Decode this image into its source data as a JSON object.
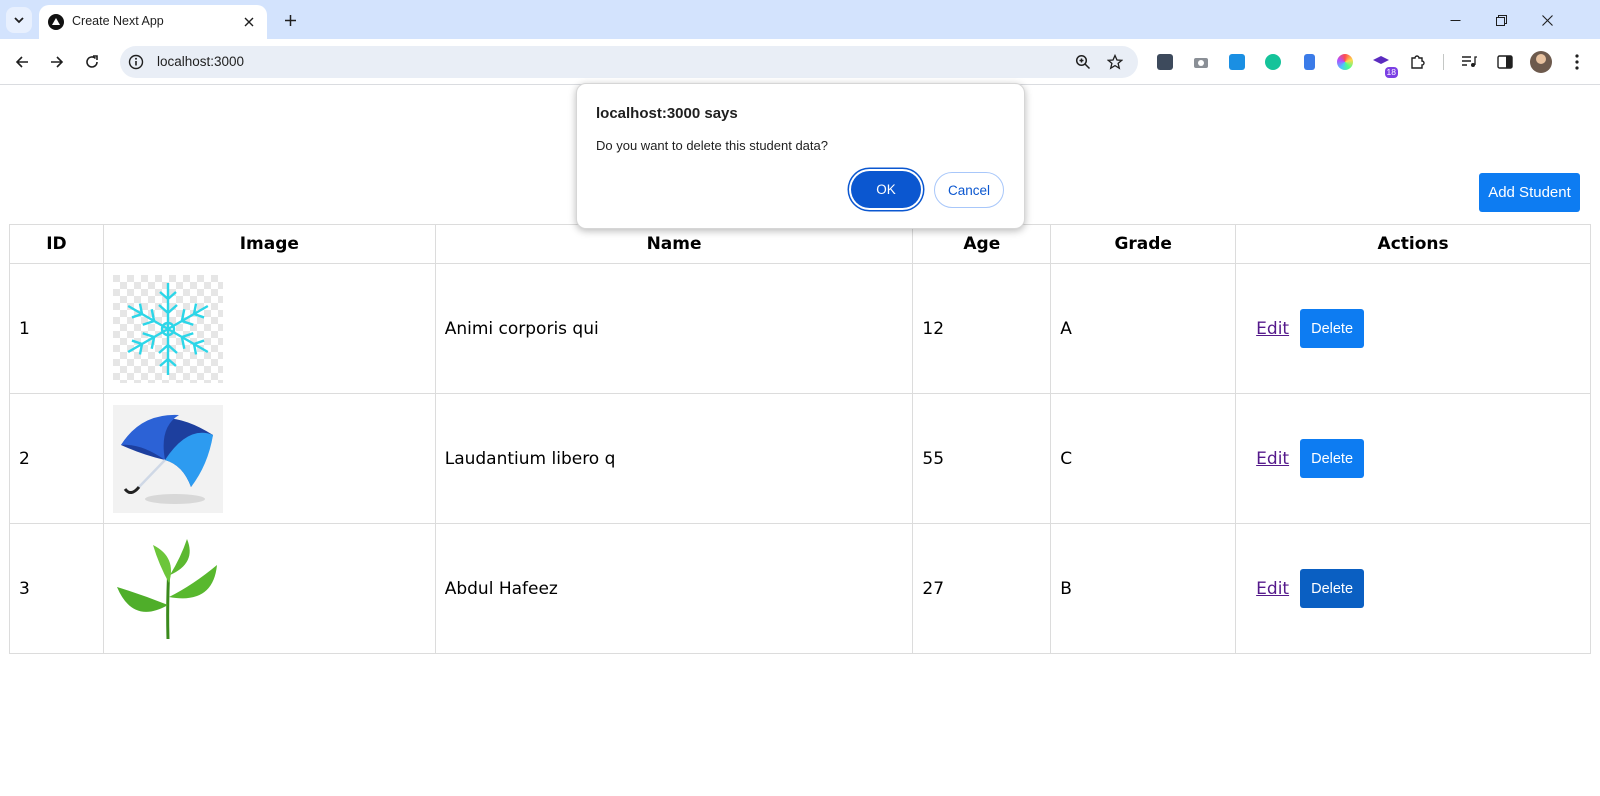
{
  "browser": {
    "tab_title": "Create Next App",
    "url": "localhost:3000",
    "extension_badge": "18"
  },
  "page": {
    "add_student_label": "Add Student",
    "table": {
      "headers": [
        "ID",
        "Image",
        "Name",
        "Age",
        "Grade",
        "Actions"
      ],
      "rows": [
        {
          "id": "1",
          "image": "snowflake-image",
          "name": "Animi corporis qui",
          "age": "12",
          "grade": "A"
        },
        {
          "id": "2",
          "image": "umbrella-image",
          "name": "Laudantium libero q",
          "age": "55",
          "grade": "C"
        },
        {
          "id": "3",
          "image": "leaves-image",
          "name": "Abdul Hafeez",
          "age": "27",
          "grade": "B"
        }
      ],
      "edit_label": "Edit",
      "delete_label": "Delete"
    }
  },
  "dialog": {
    "title": "localhost:3000 says",
    "message": "Do you want to delete this student data?",
    "ok_label": "OK",
    "cancel_label": "Cancel"
  },
  "colors": {
    "accent_button": "#0d7cf2",
    "dialog_primary": "#0b57d0",
    "tabstrip": "#d3e3fd"
  }
}
